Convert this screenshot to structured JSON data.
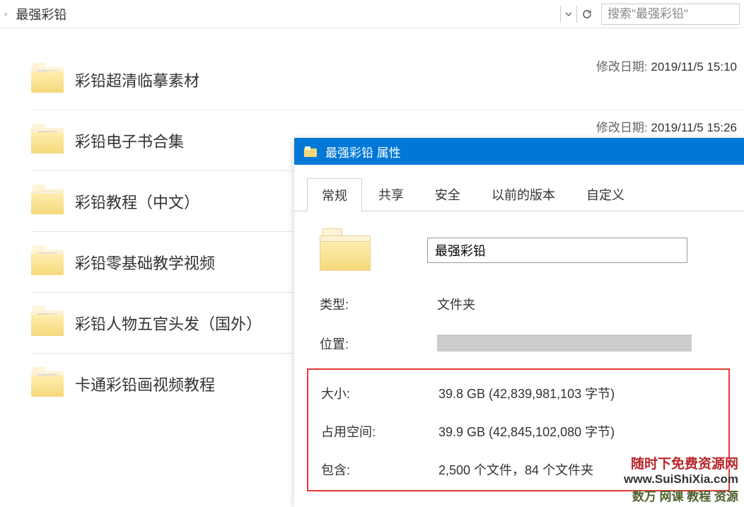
{
  "addressBar": {
    "current": "最强彩铅",
    "searchPlaceholder": "搜索\"最强彩铅\""
  },
  "files": [
    {
      "name": "彩铅超清临摹素材",
      "metaLabel": "修改日期:",
      "metaValue": "2019/11/5 15:10"
    },
    {
      "name": "彩铅电子书合集",
      "metaLabel": "修改日期:",
      "metaValue": "2019/11/5 15:26"
    },
    {
      "name": "彩铅教程（中文）",
      "metaLabel": "",
      "metaValue": ""
    },
    {
      "name": "彩铅零基础教学视频",
      "metaLabel": "",
      "metaValue": ""
    },
    {
      "name": "彩铅人物五官头发（国外）",
      "metaLabel": "",
      "metaValue": ""
    },
    {
      "name": "卡通彩铅画视频教程",
      "metaLabel": "",
      "metaValue": ""
    }
  ],
  "properties": {
    "title": "最强彩铅 属性",
    "tabs": [
      "常规",
      "共享",
      "安全",
      "以前的版本",
      "自定义"
    ],
    "folderName": "最强彩铅",
    "rows": {
      "typeLabel": "类型:",
      "typeValue": "文件夹",
      "locationLabel": "位置:",
      "sizeLabel": "大小:",
      "sizeValue": "39.8 GB (42,839,981,103 字节)",
      "diskLabel": "占用空间:",
      "diskValue": "39.9 GB (42,845,102,080 字节)",
      "containsLabel": "包含:",
      "containsValue": "2,500 个文件，84 个文件夹"
    }
  },
  "watermark": {
    "line1": "随时下免费资源网",
    "line2": "www.SuiShiXia.com",
    "line3": "数万 网课 教程 资源"
  }
}
